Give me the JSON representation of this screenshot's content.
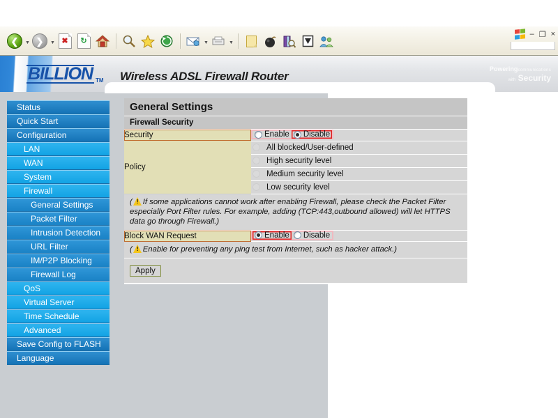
{
  "browser": {
    "toolbar_buttons": [
      {
        "name": "back",
        "label": "Back",
        "icon": "back-arrow-icon"
      },
      {
        "name": "forward",
        "label": "Forward",
        "icon": "forward-arrow-icon"
      },
      {
        "name": "stop",
        "label": "Stop",
        "icon": "stop-icon"
      },
      {
        "name": "refresh",
        "label": "Refresh",
        "icon": "refresh-icon"
      },
      {
        "name": "home",
        "label": "Home",
        "icon": "home-icon"
      },
      {
        "name": "search",
        "label": "Search",
        "icon": "search-icon"
      },
      {
        "name": "favorites",
        "label": "Favorites",
        "icon": "star-icon"
      },
      {
        "name": "history",
        "label": "History",
        "icon": "history-icon"
      },
      {
        "name": "mail",
        "label": "Mail",
        "icon": "mail-icon"
      },
      {
        "name": "print",
        "label": "Print",
        "icon": "print-icon"
      },
      {
        "name": "edit",
        "label": "Edit",
        "icon": "notepad-icon"
      },
      {
        "name": "discuss",
        "label": "Discuss",
        "icon": "bomb-icon"
      },
      {
        "name": "research",
        "label": "Research",
        "icon": "research-icon"
      },
      {
        "name": "messenger-check",
        "label": "Messenger",
        "icon": "checkbox-icon"
      },
      {
        "name": "people",
        "label": "Messenger",
        "icon": "people-icon"
      }
    ],
    "window_controls": {
      "logo": "windows-logo-icon",
      "minimize": "–",
      "restore": "❐",
      "close": "×"
    }
  },
  "header": {
    "brand": "BILLION",
    "brand_tm": "TM",
    "product_title": "Wireless ADSL Firewall Router",
    "tagline_line1_main": "Powering",
    "tagline_line1_sub": "communications",
    "tagline_line2_sub": "with",
    "tagline_line2_main": "Security",
    "brand_color": "#1752a8"
  },
  "sidebar": {
    "items": [
      {
        "label": "Status",
        "level": 1
      },
      {
        "label": "Quick Start",
        "level": 1
      },
      {
        "label": "Configuration",
        "level": 1
      },
      {
        "label": "LAN",
        "level": 2
      },
      {
        "label": "WAN",
        "level": 2
      },
      {
        "label": "System",
        "level": 2
      },
      {
        "label": "Firewall",
        "level": 2
      },
      {
        "label": "General Settings",
        "level": 3
      },
      {
        "label": "Packet Filter",
        "level": 3
      },
      {
        "label": "Intrusion Detection",
        "level": 3
      },
      {
        "label": "URL Filter",
        "level": 3
      },
      {
        "label": "IM/P2P Blocking",
        "level": 3
      },
      {
        "label": "Firewall Log",
        "level": 3
      },
      {
        "label": "QoS",
        "level": 2
      },
      {
        "label": "Virtual Server",
        "level": 2
      },
      {
        "label": "Time Schedule",
        "level": 2
      },
      {
        "label": "Advanced",
        "level": 2
      },
      {
        "label": "Save Config to FLASH",
        "level": 1
      },
      {
        "label": "Language",
        "level": 1
      }
    ]
  },
  "main": {
    "page_title": "General Settings",
    "section_title": "Firewall Security",
    "security": {
      "label": "Security",
      "enable_label": "Enable",
      "disable_label": "Disable",
      "selected": "Disable",
      "highlight_color": "#e02020"
    },
    "policy": {
      "label": "Policy",
      "options": [
        {
          "label": "All blocked/User-defined",
          "enabled": false,
          "selected": false
        },
        {
          "label": "High security level",
          "enabled": false,
          "selected": false
        },
        {
          "label": "Medium security level",
          "enabled": false,
          "selected": false
        },
        {
          "label": "Low security level",
          "enabled": false,
          "selected": false
        }
      ]
    },
    "note_firewall": "( If some applications cannot work after enabling Firewall, please check the Packet Filter especially Port Filter rules. For example, adding (TCP:443,outbound allowed) will let HTTPS data go through Firewall.)",
    "note_firewall_open": "(",
    "note_firewall_text": "If some applications cannot work after enabling Firewall, please check the Packet Filter especially Port Filter rules. For example, adding (TCP:443,outbound allowed) will let HTTPS data go through Firewall.)",
    "block_wan": {
      "label": "Block WAN Request",
      "enable_label": "Enable",
      "disable_label": "Disable",
      "selected": "Enable"
    },
    "note_block_wan_open": "(",
    "note_block_wan_text": "Enable for preventing any ping test from Internet, such as hacker attack.)",
    "apply_label": "Apply"
  }
}
